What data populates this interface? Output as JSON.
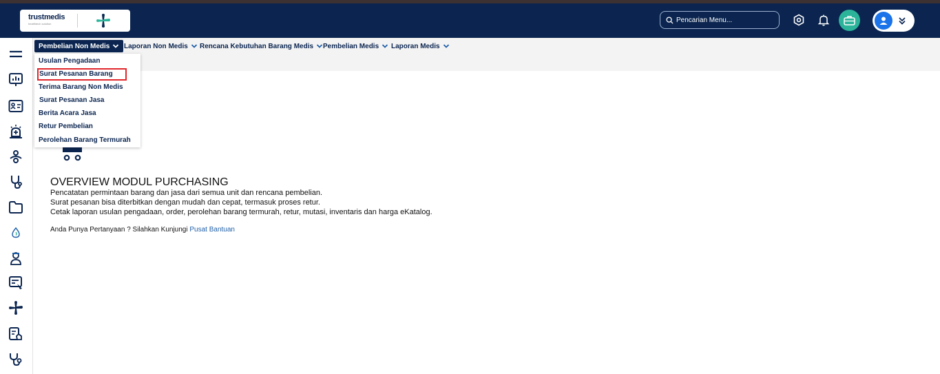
{
  "header": {
    "logo_text": "trustmedis",
    "logo_sub": "healthtech solution",
    "search_placeholder": "Pencarian Menu..."
  },
  "icons": {
    "search": "search-icon",
    "settings": "hexagon-gear-icon",
    "notifications": "bell-icon",
    "briefcase": "briefcase-icon",
    "avatar": "user-avatar-icon",
    "expand": "double-chevron-down-icon"
  },
  "colors": {
    "header_bg": "#0b2550",
    "accent_green": "#2bb49a",
    "highlight_red": "#e0262b",
    "link_blue": "#1f5fa8"
  },
  "sidebar": {
    "items": [
      "menu-icon",
      "dashboard-chart-icon",
      "id-card-icon",
      "ambulance-icon",
      "vital-sign-icon",
      "stethoscope-icon",
      "folder-icon",
      "blood-drop-icon",
      "doctor-icon",
      "form-edit-icon",
      "medical-cross-icon",
      "report-hand-icon",
      "stethoscope-alt-icon"
    ]
  },
  "nav": {
    "items": [
      {
        "label": "Pembelian Non Medis"
      },
      {
        "label": "Laporan Non Medis"
      },
      {
        "label": "Rencana Kebutuhan Barang Medis"
      },
      {
        "label": "Pembelian Medis"
      },
      {
        "label": "Laporan Medis"
      }
    ]
  },
  "dropdown": {
    "items": [
      {
        "label": "Usulan Pengadaan"
      },
      {
        "label": "Surat Pesanan Barang"
      },
      {
        "label": "Terima Barang Non Medis"
      },
      {
        "label": "Surat Pesanan Jasa"
      },
      {
        "label": "Berita Acara Jasa"
      },
      {
        "label": "Retur Pembelian"
      },
      {
        "label": "Perolehan Barang Termurah"
      }
    ],
    "highlighted": "Surat Pesanan Barang"
  },
  "overview": {
    "title": "OVERVIEW MODUL PURCHASING",
    "lines": [
      "Pencatatan permintaan barang dan jasa dari semua unit dan rencana pembelian.",
      "Surat pesanan bisa diterbitkan dengan mudah dan cepat, termasuk proses retur.",
      "Cetak laporan usulan pengadaan, order, perolehan barang termurah, retur, mutasi, inventaris dan harga eKatalog."
    ],
    "help_text": "Anda Punya Pertanyaan ? Silahkan Kunjungi ",
    "help_link": "Pusat Bantuan"
  }
}
